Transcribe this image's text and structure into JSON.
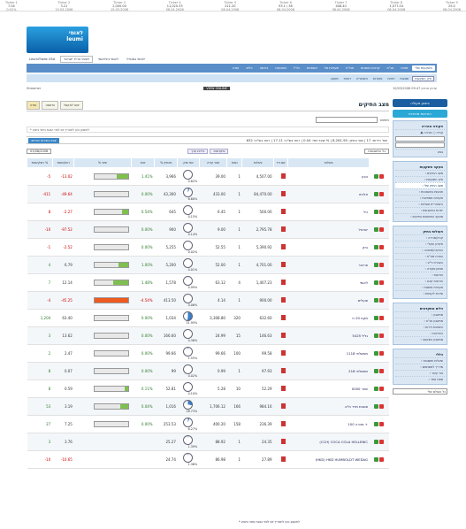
{
  "ticker": [
    {
      "name": "Ticker 1",
      "value": "7.04",
      "sub": "0.01%"
    },
    {
      "name": "Ticker 2",
      "value": "3.21",
      "sub": "15.03.2008"
    },
    {
      "name": "Ticker 3",
      "value": "2,000.00",
      "sub": "15.03.2008"
    },
    {
      "name": "Ticker 4",
      "value": "11,020.33",
      "sub": "08.04.2008"
    },
    {
      "name": "Ticker 5",
      "value": "221.20",
      "sub": "08.04.2008"
    },
    {
      "name": "Ticker 6",
      "value": "93.1 / 38",
      "sub": "08.04.2008"
    },
    {
      "name": "Ticker 7",
      "value": "408.40",
      "sub": "08.04.2008"
    },
    {
      "name": "Ticker 8",
      "value": "1,077.04",
      "sub": "08.04.2008"
    },
    {
      "name": "Ticker 9",
      "value": "25.0",
      "sub": "08.04.2008"
    }
  ],
  "logo": {
    "line1": "לאומי",
    "line2": "leumi"
  },
  "toplinks": [
    {
      "label": "LeumiTrade USA",
      "selected": false
    },
    {
      "label": "לאומי טרייד ישראל",
      "selected": true
    },
    {
      "label": "לאומי בינלאומי",
      "selected": false
    },
    {
      "label": "לאומי במובייל",
      "selected": false
    }
  ],
  "mainnav": [
    "השקעות שלי",
    "מניות",
    "אג\"ח",
    "קרנות נאמנות",
    "מט\"ח",
    "תעודות סל",
    "אופציות",
    "חו\"ל",
    "מטבעות",
    "בורסה",
    "כלים",
    "עזרה"
  ],
  "mainnav_active": 0,
  "subnav": [
    "תיק השקעות",
    "תנועות",
    "יתרות",
    "פקודות",
    "היסטוריה",
    "דוחות",
    "מעקב"
  ],
  "subnav_active": 0,
  "infobar": {
    "left": "Streamer",
    "mid": "VIEW ONLINE",
    "right": "עדכון אחרון 09:47 10/03/2008"
  },
  "page_title": "מצב התיקים",
  "buttons": {
    "print": "הדפסה",
    "excel": "יצוא לאקסל",
    "help": "עזרה"
  },
  "search_label": "חיפוש",
  "note": "* לחשבון נכון לתאריך יום לפני הצגת נתוני ביצוע",
  "summary": {
    "text": "מס' ניירות: 17 | שווי התיק: 8,281.95 | % שינוי יומי: 0.04 | רווח בש\"ח: 17.11 | רווח בש\"ח: 632",
    "go": "צפה בפירוט מורחב"
  },
  "filters": {
    "account": "כל החשבונות",
    "date": "03/08/2008",
    "tab1": "ניירות ערך",
    "tab2": "פיקדונות"
  },
  "table": {
    "headers": [
      "פעולות",
      "שם נייר",
      "פעולות",
      "כמות",
      "שער קנייה",
      "שווי שוק",
      "% מהתיק",
      "שער",
      "% שינוי",
      "רווח/הפסד",
      "רווח/הפסד %"
    ],
    "rows": [
      {
        "name": "טבע",
        "qty": "4,507.00",
        "buy": "1",
        "val": "39.00",
        "pie": 0.0062,
        "piePct": "0.62%",
        "rate": "3,966",
        "chg": "1.41%",
        "bar": 0.35,
        "barRed": false,
        "pl": "-13.02",
        "plPct": "-5",
        "plNeg": true
      },
      {
        "name": "אלביט",
        "qty": "84,470.00",
        "buy": "1",
        "val": "433.00",
        "pie": 0.066,
        "piePct": "6.60%",
        "rate": "43,300",
        "chg": "0.00%",
        "bar": 0.0,
        "barRed": false,
        "pl": "-49.64",
        "plPct": "-411",
        "plNeg": true
      },
      {
        "name": "כיל",
        "qty": "500.00",
        "buy": "1",
        "val": "6.45",
        "pie": 0.0015,
        "piePct": "0.15%",
        "rate": "645",
        "chg": "0.54%",
        "bar": 0.2,
        "barRed": false,
        "pl": "-2.27",
        "plPct": "8",
        "plNeg": true
      },
      {
        "name": "ישראל",
        "qty": "2,795.78",
        "buy": "1",
        "val": "9.00",
        "pie": 0.0014,
        "piePct": "0.14%",
        "rate": "900",
        "chg": "0.00%",
        "bar": 0.0,
        "barRed": false,
        "pl": "-97.52",
        "plPct": "-10",
        "plNeg": true
      },
      {
        "name": "בזק",
        "qty": "5,390.92",
        "buy": "1",
        "val": "52.55",
        "pie": 0.0002,
        "piePct": "0.02%",
        "rate": "5,255",
        "chg": "0.00%",
        "bar": 0.0,
        "barRed": false,
        "pl": "-2.52",
        "plPct": "-1",
        "plNeg": true
      },
      {
        "name": "פרטנר",
        "qty": "4,701.00",
        "buy": "1",
        "val": "52.00",
        "pie": 0.0001,
        "piePct": "0.01%",
        "rate": "5,200",
        "chg": "1.00%",
        "bar": 0.3,
        "barRed": false,
        "pl": "6.79",
        "plPct": "4",
        "plNeg": false
      },
      {
        "name": "לאומי",
        "qty": "1,407.23",
        "buy": "4",
        "val": "63.12",
        "pie": 0.0099,
        "piePct": "0.99%",
        "rate": "1,578",
        "chg": "1.48%",
        "bar": 0.45,
        "barRed": false,
        "pl": "12.14",
        "plPct": "7",
        "plNeg": false
      },
      {
        "name": "פועלים",
        "qty": "900.00",
        "buy": "1",
        "val": "4.14",
        "pie": 0.0006,
        "piePct": "0.06%",
        "rate": "413.50",
        "chg": "-4.54%",
        "bar": 1.0,
        "barRed": true,
        "pl": "-45.25",
        "plPct": "-4",
        "plNeg": true
      },
      {
        "name": "מקמ 20 ח",
        "qty": "632.60",
        "buy": "320",
        "val": "3,308.80",
        "pie": 0.5195,
        "piePct": "51.95%",
        "rate": "1,034",
        "chg": "0.00%",
        "bar": 0.0,
        "barRed": false,
        "pl": "63.40",
        "plPct": "1,204",
        "plNeg": false
      },
      {
        "name": "גליל 5425",
        "qty": "146.63",
        "buy": "15",
        "val": "24.99",
        "pie": 0.0036,
        "piePct": "0.36%",
        "rate": "166.60",
        "chg": "0.00%",
        "bar": 0.0,
        "barRed": false,
        "pl": "13.62",
        "plPct": "3",
        "plNeg": false
      },
      {
        "name": "ממשלתי 1118",
        "qty": "99.58",
        "buy": "100",
        "val": "99.66",
        "pie": 0.0155,
        "piePct": "1.55%",
        "rate": "99.66",
        "chg": "0.00%",
        "bar": 0.0,
        "barRed": false,
        "pl": "2.47",
        "plPct": "2",
        "plNeg": false
      },
      {
        "name": "ממשלתי 218",
        "qty": "97.93",
        "buy": "1",
        "val": "0.99",
        "pie": 0.0002,
        "piePct": "0.02%",
        "rate": "99",
        "chg": "0.00%",
        "bar": 0.0,
        "barRed": false,
        "pl": "0.07",
        "plPct": "8",
        "plNeg": false
      },
      {
        "name": "שחר 0000",
        "qty": "52.29",
        "buy": "10",
        "val": "5.28",
        "pie": 0.001,
        "piePct": "0.10%",
        "rate": "52.81",
        "chg": "0.11%",
        "bar": 0.1,
        "barRed": false,
        "pl": "0.59",
        "plPct": "8",
        "plNeg": false
      },
      {
        "name": "פסגות מדד ת\"א",
        "qty": "984.16",
        "buy": "166",
        "val": "1,706.12",
        "pie": 0.2673,
        "piePct": "26.73%",
        "rate": "1,016",
        "chg": "0.04%",
        "bar": 0.25,
        "barRed": false,
        "pl": "3.19",
        "plPct": "53",
        "plNeg": false
      },
      {
        "name": "מנורה 100 +",
        "qty": "236.39",
        "buy": "158",
        "val": "400.20",
        "pie": 0.0627,
        "piePct": "6.27%",
        "rate": "253.53",
        "chg": "0.00%",
        "bar": 0.0,
        "barRed": false,
        "pl": "7.25",
        "plPct": "27",
        "plNeg": false
      },
      {
        "name": "(CCH) COCA COLA HELLENIC",
        "qty": "24.35",
        "buy": "1",
        "val": "88.92",
        "pie": 0.0139,
        "piePct": "1.39%",
        "rate": "25.27",
        "chg": "",
        "bar": -1,
        "barRed": false,
        "pl": "3.76",
        "plPct": "3",
        "plNeg": false
      },
      {
        "name": "(HKD) HKD HUMBOLDT WEDAG",
        "qty": "27.89",
        "buy": "1",
        "val": "86.98",
        "pie": 0.0136,
        "piePct": "1.36%",
        "rate": "24.74",
        "chg": "",
        "bar": -1,
        "barRed": false,
        "pl": "-10.65",
        "plPct": "-10",
        "plNeg": true
      }
    ]
  },
  "sidebar": {
    "order_button": "ביצוע פעולה",
    "quick_button": "הוראות מהירות",
    "quick_title": "פקודה מהירה",
    "radio_buy": "קנייה",
    "radio_sell": "מכירה",
    "go_button": "בצע",
    "groups": [
      {
        "title": "מעקב השקעות",
        "items": [
          "מצב התיקים",
          "תיק השקעות",
          "מצב התיק שלי",
          "תנועות בחשבונות",
          "פקודות ממתינות",
          "היסטוריית פעולות",
          "יתרות בחשבונות",
          "מעקב התשואות בתיקים"
        ],
        "active": 2
      },
      {
        "title": "פעולות בתיק",
        "items": [
          "קניה/מכירה",
          "פיקדון שקלי",
          "הפקדה/משיכה",
          "המרת מט\"ח",
          "העברת ני\"ע",
          "תזמון פקודה",
          "הודעות",
          "הוראות קבע",
          "פקודות מותנות",
          "שירות לקוחות"
        ],
        "active": -1
      },
      {
        "title": "כלים מתקדמים",
        "items": [
          "מחשבון",
          "מחשבון אג\"ח",
          "השוואת ניירות",
          "התראות",
          "מחשבון השקעה"
        ],
        "active": -1
      },
      {
        "title": "כללי",
        "items": [
          "שאלות ותשובות",
          "מדריך למשתמש",
          "צור קשר",
          "מפת אתר"
        ],
        "active": -1
      }
    ],
    "select_label": "כל העולם שלי"
  },
  "footer": "* לחשבון נכון לתאריך יום לפני הצגת נתוני ביצוע"
}
